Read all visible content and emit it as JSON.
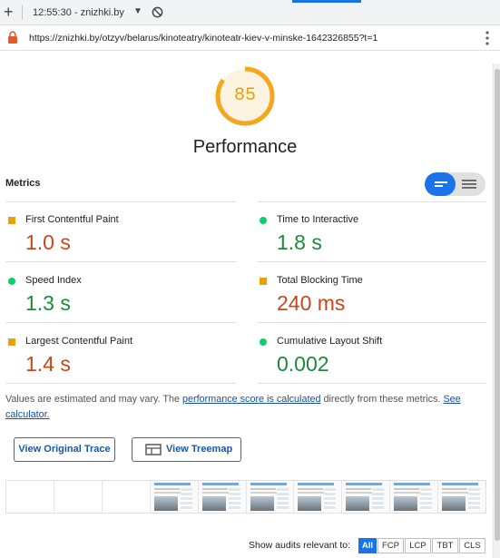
{
  "browser": {
    "new_tab_glyph": "+",
    "tab_title": "12:55:30 - znizhki.by",
    "dropdown_glyph": "▼",
    "url": "https://znizhki.by/otzyv/belarus/kinoteatry/kinoteatr-kiev-v-minske-1642326855?t=1",
    "icons": [
      "plus-icon",
      "chevron-down-icon",
      "block-icon",
      "lock-icon",
      "more-vert-icon"
    ]
  },
  "gauge": {
    "score": "85",
    "score_fraction": 0.85,
    "title": "Performance",
    "color": "#f4a61c"
  },
  "metrics": {
    "title": "Metrics",
    "items": [
      {
        "label": "First Contentful Paint",
        "value": "1.0 s",
        "status": "average"
      },
      {
        "label": "Time to Interactive",
        "value": "1.8 s",
        "status": "pass"
      },
      {
        "label": "Speed Index",
        "value": "1.3 s",
        "status": "pass"
      },
      {
        "label": "Total Blocking Time",
        "value": "240 ms",
        "status": "average"
      },
      {
        "label": "Largest Contentful Paint",
        "value": "1.4 s",
        "status": "average"
      },
      {
        "label": "Cumulative Layout Shift",
        "value": "0.002",
        "status": "pass"
      }
    ]
  },
  "note": {
    "prefix": "Values are estimated and may vary. The ",
    "link1": "performance score is calculated",
    "middle": " directly from these metrics. ",
    "link2": "See calculator."
  },
  "buttons": {
    "trace": "View Original Trace",
    "treemap": "View Treemap"
  },
  "audits": {
    "label": "Show audits relevant to:",
    "chips": [
      "All",
      "FCP",
      "LCP",
      "TBT",
      "CLS"
    ],
    "active": "All"
  },
  "colors": {
    "average": "#e8a200",
    "pass": "#0cce6b",
    "accent": "#1a73e8",
    "value_average": "#c5481a",
    "value_pass": "#1b8a3c"
  }
}
